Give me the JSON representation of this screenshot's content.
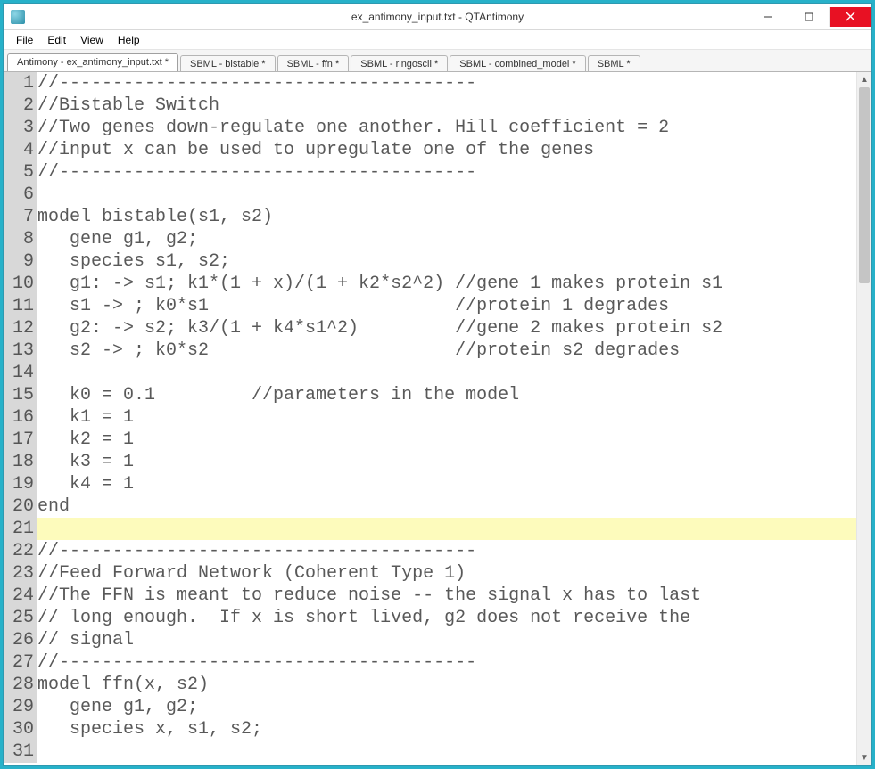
{
  "window": {
    "title": "ex_antimony_input.txt - QTAntimony"
  },
  "menu": {
    "file": "File",
    "edit": "Edit",
    "view": "View",
    "help": "Help"
  },
  "tabs": [
    {
      "label": "Antimony - ex_antimony_input.txt *",
      "active": true
    },
    {
      "label": "SBML - bistable *",
      "active": false
    },
    {
      "label": "SBML - ffn *",
      "active": false
    },
    {
      "label": "SBML - ringoscil *",
      "active": false
    },
    {
      "label": "SBML - combined_model *",
      "active": false
    },
    {
      "label": "SBML *",
      "active": false
    }
  ],
  "editor": {
    "highlighted_line": 21,
    "lines": [
      "//---------------------------------------",
      "//Bistable Switch",
      "//Two genes down-regulate one another. Hill coefficient = 2",
      "//input x can be used to upregulate one of the genes",
      "//---------------------------------------",
      "",
      "model bistable(s1, s2)",
      "   gene g1, g2;",
      "   species s1, s2;",
      "   g1: -> s1; k1*(1 + x)/(1 + k2*s2^2) //gene 1 makes protein s1",
      "   s1 -> ; k0*s1                       //protein 1 degrades",
      "   g2: -> s2; k3/(1 + k4*s1^2)         //gene 2 makes protein s2",
      "   s2 -> ; k0*s2                       //protein s2 degrades",
      "",
      "   k0 = 0.1         //parameters in the model",
      "   k1 = 1",
      "   k2 = 1",
      "   k3 = 1",
      "   k4 = 1",
      "end",
      "",
      "//---------------------------------------",
      "//Feed Forward Network (Coherent Type 1)",
      "//The FFN is meant to reduce noise -- the signal x has to last",
      "// long enough.  If x is short lived, g2 does not receive the ",
      "// signal",
      "//---------------------------------------",
      "model ffn(x, s2)",
      "   gene g1, g2;",
      "   species x, s1, s2;",
      ""
    ]
  }
}
